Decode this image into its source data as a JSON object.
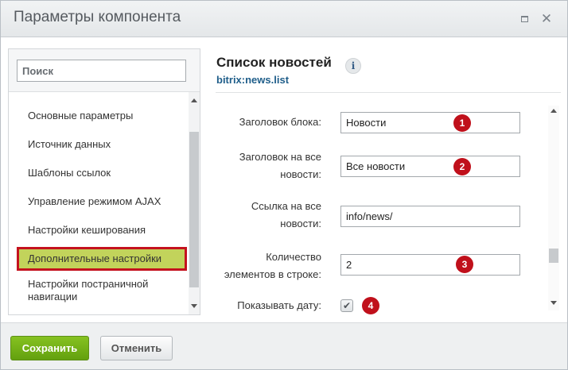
{
  "window": {
    "title": "Параметры компонента",
    "maximize_icon": "maximize-icon",
    "close_icon": "close-icon",
    "close_glyph": "✕"
  },
  "sidebar": {
    "search_placeholder": "Поиск",
    "items": [
      {
        "label": "Основные параметры"
      },
      {
        "label": "Источник данных"
      },
      {
        "label": "Шаблоны ссылок"
      },
      {
        "label": "Управление режимом AJAX"
      },
      {
        "label": "Настройки кеширования"
      },
      {
        "label": "Дополнительные настройки",
        "active": true
      },
      {
        "label": "Настройки постраничной навигации"
      }
    ]
  },
  "component": {
    "title": "Список новостей",
    "info_glyph": "i",
    "code": "bitrix:news.list"
  },
  "params": [
    {
      "label": "Заголовок блока:",
      "value": "Новости",
      "badge": "1"
    },
    {
      "label": "Заголовок на все новости:",
      "value": "Все новости",
      "badge": "2"
    },
    {
      "label": "Ссылка на все новости:",
      "value": "info/news/"
    },
    {
      "label": "Количество элементов в строке:",
      "value": "2",
      "badge": "3"
    },
    {
      "label": "Показывать дату:",
      "checked": true,
      "check_glyph": "✔",
      "badge": "4"
    }
  ],
  "footer": {
    "save_label": "Сохранить",
    "cancel_label": "Отменить"
  },
  "colors": {
    "accent_green": "#6aab14",
    "active_item_bg": "#c2d35b",
    "highlight_border": "#c4121e",
    "badge_red": "#c0101b",
    "code_blue": "#1f5e8a"
  }
}
